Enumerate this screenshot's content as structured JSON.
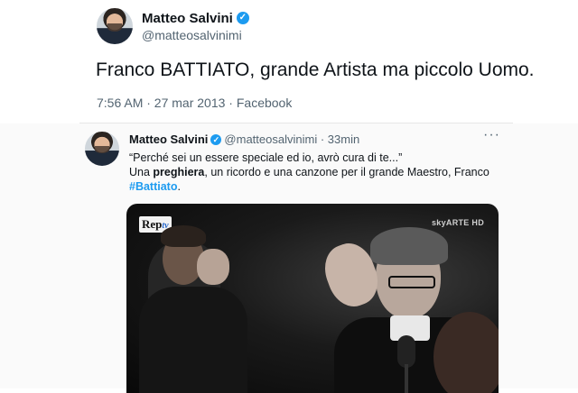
{
  "tweet_main": {
    "author_name": "Matteo Salvini",
    "handle": "@matteosalvinimi",
    "text": "Franco BATTIATO, grande Artista ma piccolo Uomo.",
    "meta": "7:56 AM · 27 mar 2013 · Facebook"
  },
  "tweet_embedded": {
    "author_name": "Matteo Salvini",
    "handle": "@matteosalvinimi",
    "separator": "·",
    "time": "33min",
    "more_icon": "more-icon",
    "line1": "“Perché sei un essere speciale ed io, avrò cura di te...”",
    "line2_pre": "Una ",
    "line2_bold": "preghiera",
    "line2_post": ", un ricordo e una canzone per il grande Maestro, Franco",
    "hashtag": "#Battiato",
    "hashtag_suffix": ".",
    "video": {
      "logo_left_main": "Rep",
      "logo_left_sub": "tv",
      "logo_right": "skyARTE HD"
    }
  },
  "colors": {
    "link": "#1d9bf0",
    "secondary_text": "#536471",
    "verified_badge": "#1d9bf0"
  }
}
